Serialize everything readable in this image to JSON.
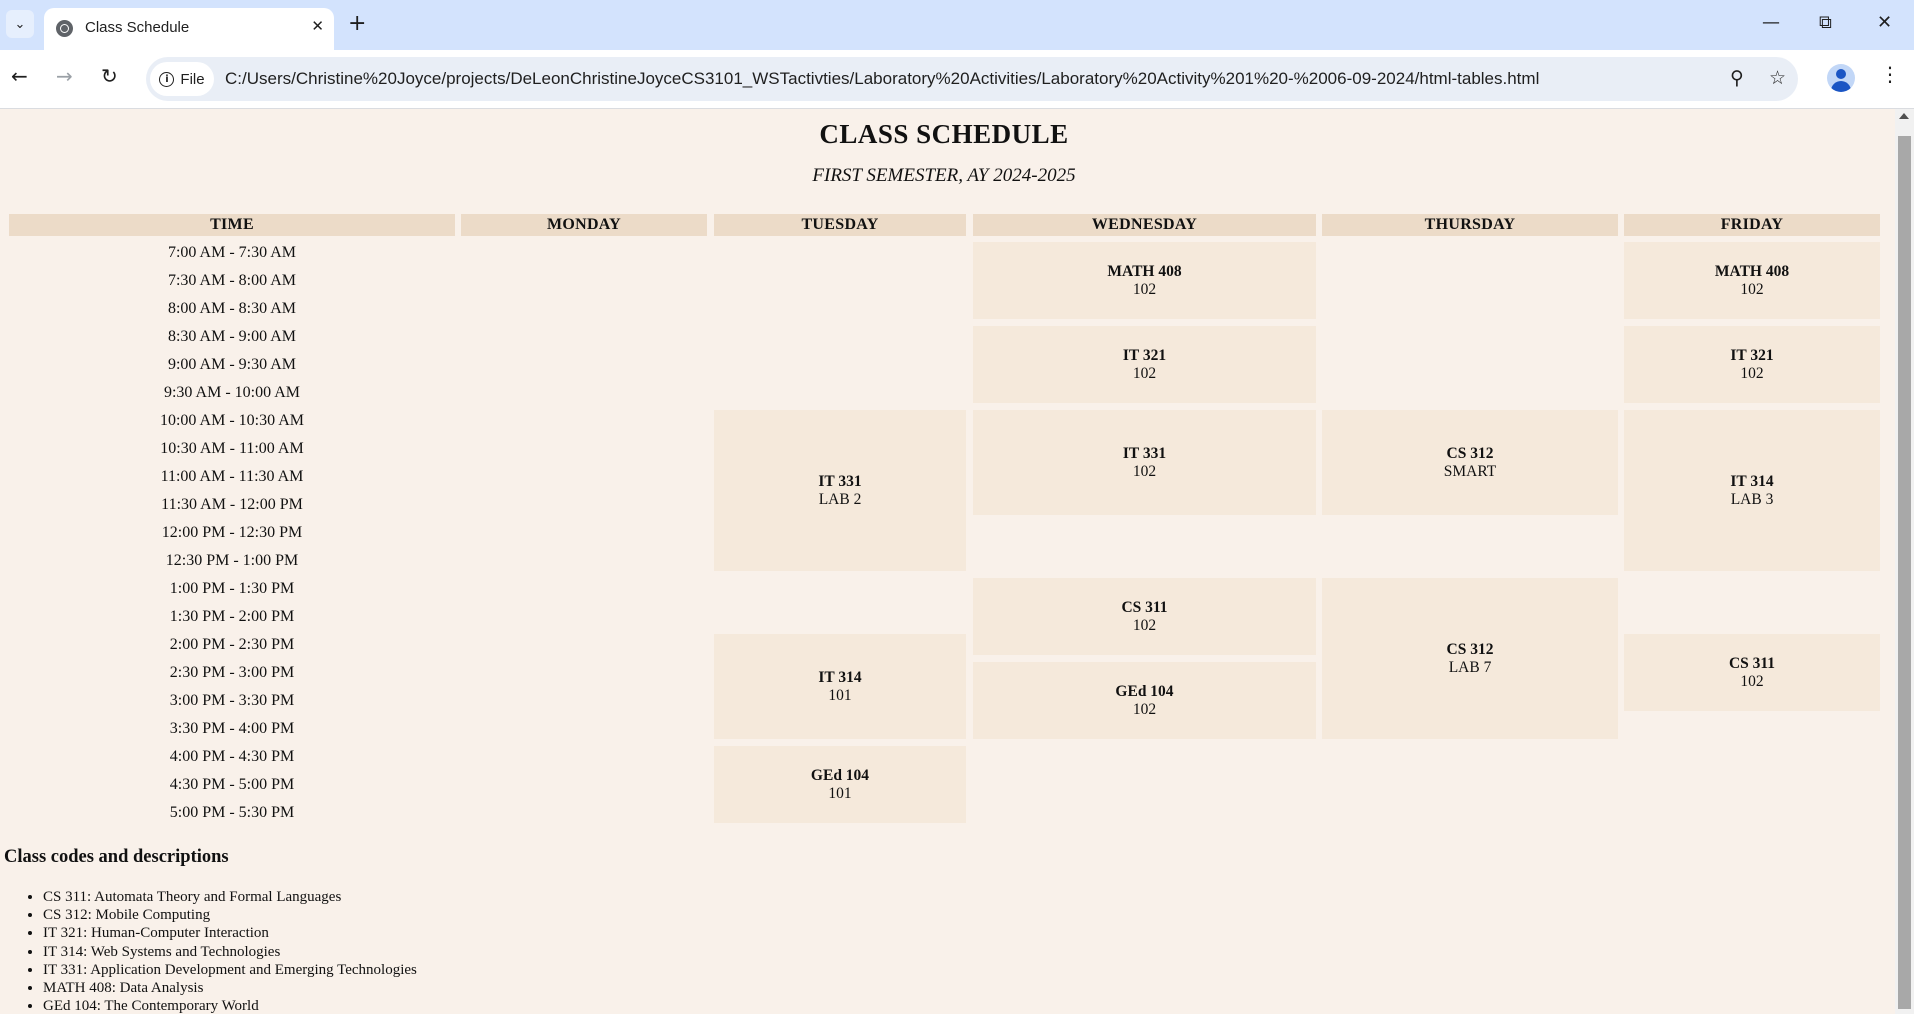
{
  "browser": {
    "tab_title": "Class Schedule",
    "site_chip": "File",
    "url": "C:/Users/Christine%20Joyce/projects/DeLeonChristineJoyceCS3101_WSTactivties/Laboratory%20Activities/Laboratory%20Activity%201%20-%2006-09-2024/html-tables.html"
  },
  "page": {
    "title": "CLASS SCHEDULE",
    "subtitle": "FIRST SEMESTER, AY 2024-2025",
    "headers": [
      "TIME",
      "MONDAY",
      "TUESDAY",
      "WEDNESDAY",
      "THURSDAY",
      "FRIDAY"
    ],
    "times": [
      "7:00 AM - 7:30 AM",
      "7:30 AM - 8:00 AM",
      "8:00 AM - 8:30 AM",
      "8:30 AM - 9:00 AM",
      "9:00 AM - 9:30 AM",
      "9:30 AM - 10:00 AM",
      "10:00 AM - 10:30 AM",
      "10:30 AM - 11:00 AM",
      "11:00 AM - 11:30 AM",
      "11:30 AM - 12:00 PM",
      "12:00 PM - 12:30 PM",
      "12:30 PM - 1:00 PM",
      "1:00 PM - 1:30 PM",
      "1:30 PM - 2:00 PM",
      "2:00 PM - 2:30 PM",
      "2:30 PM - 3:00 PM",
      "3:00 PM - 3:30 PM",
      "3:30 PM - 4:00 PM",
      "4:00 PM - 4:30 PM",
      "4:30 PM - 5:00 PM",
      "5:00 PM - 5:30 PM"
    ],
    "classes": {
      "tue_it331": {
        "code": "IT 331",
        "room": "LAB 2"
      },
      "tue_it314": {
        "code": "IT 314",
        "room": "101"
      },
      "tue_ged104": {
        "code": "GEd 104",
        "room": "101"
      },
      "wed_math408": {
        "code": "MATH 408",
        "room": "102"
      },
      "wed_it321": {
        "code": "IT 321",
        "room": "102"
      },
      "wed_it331": {
        "code": "IT 331",
        "room": "102"
      },
      "wed_cs311": {
        "code": "CS 311",
        "room": "102"
      },
      "wed_ged104": {
        "code": "GEd 104",
        "room": "102"
      },
      "thu_cs312a": {
        "code": "CS 312",
        "room": "SMART"
      },
      "thu_cs312b": {
        "code": "CS 312",
        "room": "LAB 7"
      },
      "fri_math408": {
        "code": "MATH 408",
        "room": "102"
      },
      "fri_it321": {
        "code": "IT 321",
        "room": "102"
      },
      "fri_it314": {
        "code": "IT 314",
        "room": "LAB 3"
      },
      "fri_cs311": {
        "code": "CS 311",
        "room": "102"
      }
    },
    "codes_heading": "Class codes and descriptions",
    "codes": [
      "CS 311: Automata Theory and Formal Languages",
      "CS 312: Mobile Computing",
      "IT 321: Human-Computer Interaction",
      "IT 314: Web Systems and Technologies",
      "IT 331: Application Development and Emerging Technologies",
      "MATH 408: Data Analysis",
      "GEd 104: The Contemporary World"
    ]
  }
}
